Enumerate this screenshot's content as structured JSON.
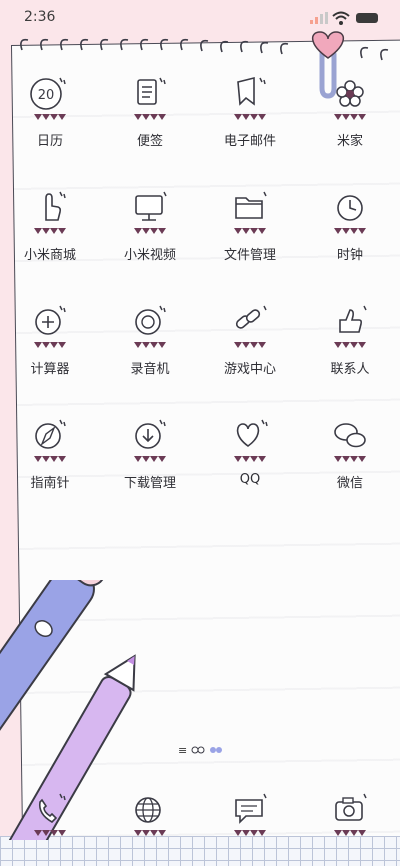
{
  "status_bar": {
    "time": "2:36"
  },
  "apps": [
    {
      "label": "日历",
      "icon": "calendar-icon",
      "day": "20"
    },
    {
      "label": "便签",
      "icon": "notes-icon"
    },
    {
      "label": "电子邮件",
      "icon": "email-icon"
    },
    {
      "label": "米家",
      "icon": "flower-icon"
    },
    {
      "label": "小米商城",
      "icon": "shop-hand-icon"
    },
    {
      "label": "小米视频",
      "icon": "video-monitor-icon"
    },
    {
      "label": "文件管理",
      "icon": "folder-icon"
    },
    {
      "label": "时钟",
      "icon": "clock-icon"
    },
    {
      "label": "计算器",
      "icon": "calculator-plus-icon"
    },
    {
      "label": "录音机",
      "icon": "recorder-icon"
    },
    {
      "label": "游戏中心",
      "icon": "game-link-icon"
    },
    {
      "label": "联系人",
      "icon": "thumbs-up-icon"
    },
    {
      "label": "指南针",
      "icon": "compass-icon"
    },
    {
      "label": "下载管理",
      "icon": "download-icon"
    },
    {
      "label": "QQ",
      "icon": "heart-icon"
    },
    {
      "label": "微信",
      "icon": "chat-bubbles-icon"
    }
  ],
  "dock": [
    {
      "icon": "phone-icon"
    },
    {
      "icon": "browser-globe-icon"
    },
    {
      "icon": "messages-icon"
    },
    {
      "icon": "camera-icon"
    }
  ],
  "colors": {
    "accent": "#f1a8bc",
    "pennant": "#6b3b55",
    "ink": "#3b3b45",
    "pencil_blue": "#9aa3e6",
    "pencil_purple": "#d7b7f0"
  }
}
